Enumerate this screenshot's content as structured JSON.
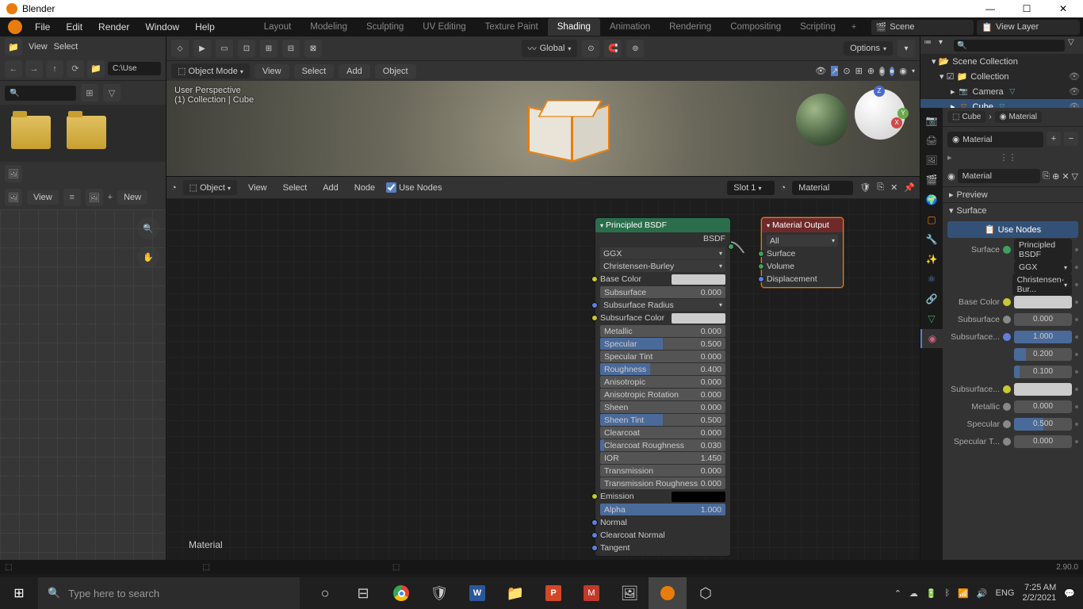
{
  "titlebar": {
    "app": "Blender"
  },
  "menubar": {
    "file": "File",
    "edit": "Edit",
    "render": "Render",
    "window": "Window",
    "help": "Help"
  },
  "workspaces": {
    "items": [
      "Layout",
      "Modeling",
      "Sculpting",
      "UV Editing",
      "Texture Paint",
      "Shading",
      "Animation",
      "Rendering",
      "Compositing",
      "Scripting"
    ],
    "active": "Shading"
  },
  "scene": {
    "label": "Scene"
  },
  "view_layer": {
    "label": "View Layer"
  },
  "filebrowser": {
    "view": "View",
    "select": "Select",
    "path": "C:\\Use",
    "view2": "View",
    "new": "New"
  },
  "viewport": {
    "orientation": "Global",
    "options": "Options",
    "mode": "Object Mode",
    "view": "View",
    "select": "Select",
    "add": "Add",
    "object": "Object",
    "overlay1": "User Perspective",
    "overlay2": "(1) Collection | Cube"
  },
  "node_editor": {
    "mode": "Object",
    "view": "View",
    "select": "Select",
    "add": "Add",
    "node": "Node",
    "use_nodes": "Use Nodes",
    "slot": "Slot 1",
    "material": "Material",
    "material_label": "Material"
  },
  "bsdf": {
    "title": "Principled BSDF",
    "out": "BSDF",
    "distribution": "GGX",
    "subsurface_method": "Christensen-Burley",
    "rows": [
      {
        "label": "Base Color",
        "type": "color"
      },
      {
        "label": "Subsurface",
        "type": "slider",
        "value": "0.000",
        "fill": 0
      },
      {
        "label": "Subsurface Radius",
        "type": "drop"
      },
      {
        "label": "Subsurface Color",
        "type": "color"
      },
      {
        "label": "Metallic",
        "type": "slider",
        "value": "0.000",
        "fill": 0
      },
      {
        "label": "Specular",
        "type": "slider",
        "value": "0.500",
        "fill": 50
      },
      {
        "label": "Specular Tint",
        "type": "slider",
        "value": "0.000",
        "fill": 0
      },
      {
        "label": "Roughness",
        "type": "slider",
        "value": "0.400",
        "fill": 40
      },
      {
        "label": "Anisotropic",
        "type": "slider",
        "value": "0.000",
        "fill": 0
      },
      {
        "label": "Anisotropic Rotation",
        "type": "slider",
        "value": "0.000",
        "fill": 0
      },
      {
        "label": "Sheen",
        "type": "slider",
        "value": "0.000",
        "fill": 0
      },
      {
        "label": "Sheen Tint",
        "type": "slider",
        "value": "0.500",
        "fill": 50
      },
      {
        "label": "Clearcoat",
        "type": "slider",
        "value": "0.000",
        "fill": 0
      },
      {
        "label": "Clearcoat Roughness",
        "type": "slider",
        "value": "0.030",
        "fill": 3
      },
      {
        "label": "IOR",
        "type": "slider",
        "value": "1.450",
        "fill": 0
      },
      {
        "label": "Transmission",
        "type": "slider",
        "value": "0.000",
        "fill": 0
      },
      {
        "label": "Transmission Roughness",
        "type": "slider",
        "value": "0.000",
        "fill": 0
      },
      {
        "label": "Emission",
        "type": "color",
        "emission": true
      },
      {
        "label": "Alpha",
        "type": "slider",
        "value": "1.000",
        "fill": 100
      },
      {
        "label": "Normal",
        "type": "vec"
      },
      {
        "label": "Clearcoat Normal",
        "type": "vec"
      },
      {
        "label": "Tangent",
        "type": "vec"
      }
    ]
  },
  "output_node": {
    "title": "Material Output",
    "target": "All",
    "inputs": [
      "Surface",
      "Volume",
      "Displacement"
    ]
  },
  "outliner": {
    "root": "Scene Collection",
    "collection": "Collection",
    "items": [
      {
        "name": "Camera",
        "icon": "📷"
      },
      {
        "name": "Cube",
        "icon": "▽",
        "selected": true
      }
    ]
  },
  "props": {
    "breadcrumb_cube": "Cube",
    "breadcrumb_mat": "Material",
    "matslot": "Material",
    "browse_mat": "Material",
    "preview": "Preview",
    "surface": "Surface",
    "use_nodes": "Use Nodes",
    "surface_label": "Surface",
    "surface_value": "Principled BSDF",
    "dist": "GGX",
    "ss_method": "Christensen-Bur...",
    "rows": [
      {
        "label": "Base Color",
        "type": "swatch",
        "sock": "color"
      },
      {
        "label": "Subsurface",
        "type": "slider",
        "value": "0.000",
        "fill": 0,
        "sock": "gray"
      },
      {
        "label": "Subsurface...",
        "type": "slider",
        "value": "1.000",
        "fill": 100,
        "sock": "vec"
      },
      {
        "label": "",
        "type": "slider",
        "value": "0.200",
        "fill": 20
      },
      {
        "label": "",
        "type": "slider",
        "value": "0.100",
        "fill": 10
      },
      {
        "label": "Subsurface...",
        "type": "swatch",
        "sock": "color"
      },
      {
        "label": "Metallic",
        "type": "slider",
        "value": "0.000",
        "fill": 0,
        "sock": "gray"
      },
      {
        "label": "Specular",
        "type": "slider",
        "value": "0.500",
        "fill": 50,
        "sock": "gray"
      },
      {
        "label": "Specular T...",
        "type": "slider",
        "value": "0.000",
        "fill": 0,
        "sock": "gray"
      }
    ]
  },
  "status": {
    "version": "2.90.0"
  },
  "taskbar": {
    "search_placeholder": "Type here to search",
    "lang": "ENG",
    "time": "7:25 AM",
    "date": "2/2/2021"
  }
}
